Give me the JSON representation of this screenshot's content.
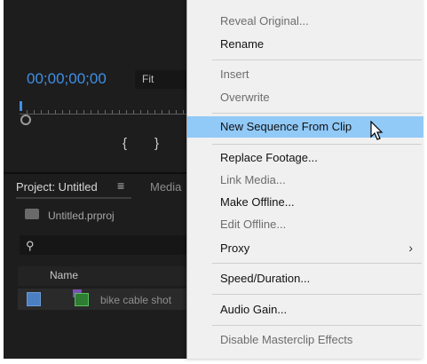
{
  "monitor": {
    "timecode": "00;00;00;00",
    "zoom_select": "Fit",
    "in_mark": "{",
    "out_mark": "}"
  },
  "project_panel": {
    "tab_label": "Project: Untitled",
    "tab_menu_icon": "≡",
    "next_tab_label": "Media",
    "project_file": "Untitled.prproj",
    "search_icon": "search-icon",
    "column_name": "Name",
    "items": [
      {
        "name": "bike cable shot"
      }
    ]
  },
  "context_menu": {
    "items": [
      {
        "label": "Reveal Original...",
        "enabled": false
      },
      {
        "label": "Rename",
        "enabled": true
      },
      {
        "label": "Insert",
        "enabled": false
      },
      {
        "label": "Overwrite",
        "enabled": false
      },
      {
        "label": "New Sequence From Clip",
        "enabled": true,
        "highlighted": true
      },
      {
        "label": "Replace Footage...",
        "enabled": true
      },
      {
        "label": "Link Media...",
        "enabled": false
      },
      {
        "label": "Make Offline...",
        "enabled": true
      },
      {
        "label": "Edit Offline...",
        "enabled": false
      },
      {
        "label": "Proxy",
        "enabled": true,
        "submenu": true
      },
      {
        "label": "Speed/Duration...",
        "enabled": true
      },
      {
        "label": "Audio Gain...",
        "enabled": true
      },
      {
        "label": "Disable Masterclip Effects",
        "enabled": false
      }
    ],
    "submenu_arrow": "›"
  },
  "colors": {
    "timecode_blue": "#3f8fe6",
    "highlight": "#91c9f7",
    "label_swatch": "#4b7fc2"
  }
}
